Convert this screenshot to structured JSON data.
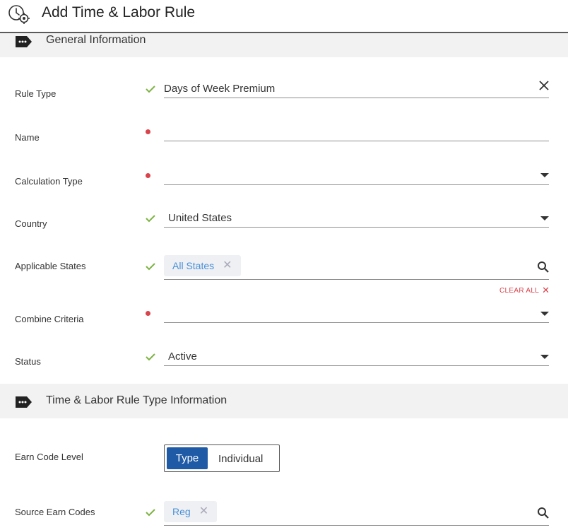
{
  "header": {
    "title": "Add Time & Labor Rule",
    "icon": "clock-gear-icon"
  },
  "sections": {
    "general": {
      "title": "General Information",
      "icon": "more-tag-icon"
    },
    "type_info": {
      "title": "Time & Labor Rule Type Information",
      "icon": "more-tag-icon"
    }
  },
  "fields": {
    "rule_type": {
      "label": "Rule Type",
      "value": "Days of Week Premium",
      "status": "valid"
    },
    "name": {
      "label": "Name",
      "value": "",
      "status": "required"
    },
    "calculation_type": {
      "label": "Calculation Type",
      "value": "",
      "status": "required"
    },
    "country": {
      "label": "Country",
      "value": "United States",
      "status": "valid"
    },
    "applicable_states": {
      "label": "Applicable States",
      "chips": [
        "All States"
      ],
      "clear_all": "CLEAR ALL",
      "status": "valid"
    },
    "combine_criteria": {
      "label": "Combine Criteria",
      "value": "",
      "status": "required"
    },
    "status": {
      "label": "Status",
      "value": "Active",
      "status": "valid"
    },
    "earn_code_level": {
      "label": "Earn Code Level",
      "options": [
        "Type",
        "Individual"
      ],
      "selected": "Type"
    },
    "source_earn_codes": {
      "label": "Source Earn Codes",
      "chips": [
        "Reg"
      ],
      "status": "valid"
    }
  },
  "colors": {
    "accent": "#1f5aa6",
    "valid": "#7cb342",
    "required": "#d9434b",
    "chip_text": "#4a90d9"
  }
}
